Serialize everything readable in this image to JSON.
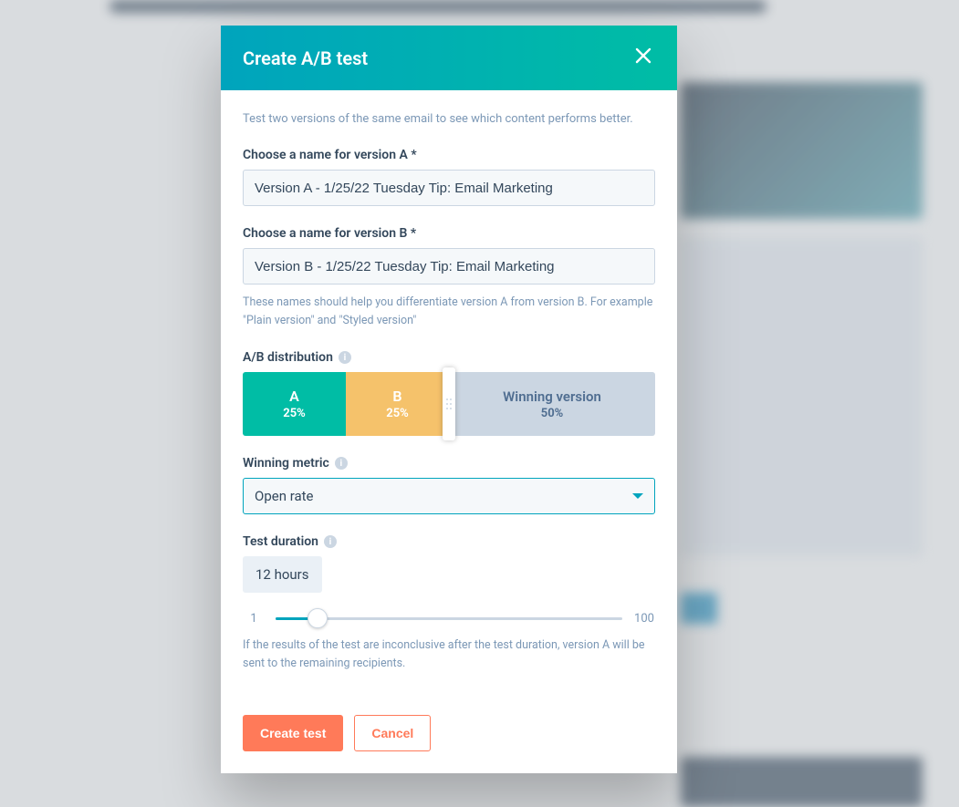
{
  "modal": {
    "title": "Create A/B test",
    "intro": "Test two versions of the same email to see which content performs better.",
    "versionA": {
      "label": "Choose a name for version A *",
      "value": "Version A - 1/25/22 Tuesday Tip: Email Marketing"
    },
    "versionB": {
      "label": "Choose a name for version B *",
      "value": "Version B - 1/25/22 Tuesday Tip: Email Marketing"
    },
    "namesHelper": "These names should help you differentiate version A from version B. For example \"Plain version\" and \"Styled version\"",
    "distribution": {
      "label": "A/B distribution",
      "a": {
        "title": "A",
        "pct": "25%"
      },
      "b": {
        "title": "B",
        "pct": "25%"
      },
      "winner": {
        "title": "Winning version",
        "pct": "50%"
      }
    },
    "winningMetric": {
      "label": "Winning metric",
      "value": "Open rate"
    },
    "testDuration": {
      "label": "Test duration",
      "value": "12 hours",
      "min": "1",
      "max": "100",
      "helper": "If the results of the test are inconclusive after the test duration, version A will be sent to the remaining recipients."
    },
    "actions": {
      "primary": "Create test",
      "secondary": "Cancel"
    }
  }
}
